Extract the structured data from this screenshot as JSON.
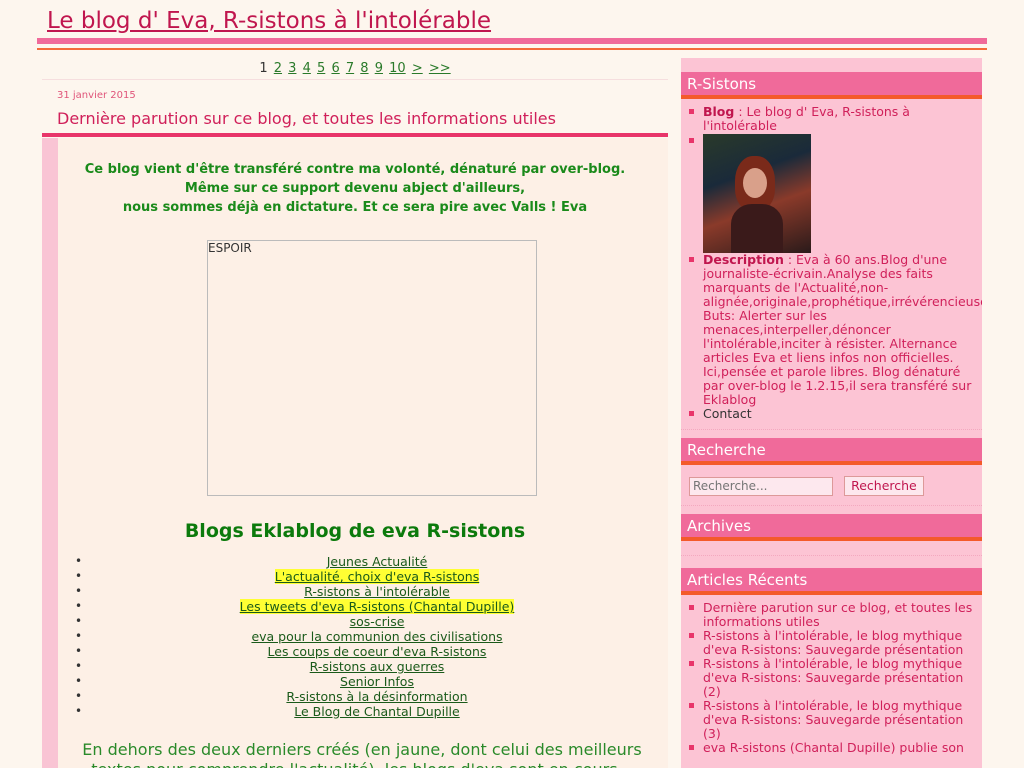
{
  "site": {
    "title": "Le blog d' Eva, R-sistons à l'intolérable"
  },
  "pager": {
    "current": "1",
    "pages": [
      "2",
      "3",
      "4",
      "5",
      "6",
      "7",
      "8",
      "9",
      "10"
    ],
    "next": ">",
    "last": ">>"
  },
  "post": {
    "date": "31 janvier 2015",
    "title": "Dernière parution sur ce blog, et toutes les informations utiles",
    "intro": [
      "Ce blog vient d'être transféré contre ma volonté, dénaturé par over-blog.",
      "Même sur ce support devenu abject d'ailleurs,",
      "nous sommes déjà en dictature. Et ce sera pire avec Valls ! Eva"
    ],
    "frame_label": "ESPOIR",
    "blogs_heading": "Blogs Eklablog de eva R-sistons",
    "blogs": [
      "Jeunes Actualité",
      "L'actualité, choix d'eva R-sistons",
      "R-sistons à l'intolérable",
      "Les tweets d'eva R-sistons (Chantal Dupille)",
      "sos-crise",
      "eva pour la communion des civilisations",
      "Les coups de coeur d'eva R-sistons",
      "R-sistons aux guerres",
      "Senior Infos",
      "R-sistons à la désinformation",
      "Le Blog de Chantal Dupille"
    ],
    "outro": "En dehors des deux derniers créés (en jaune, dont celui des meilleurs textes pour comprendre l'actualité), les blogs d'eva sont en cours... assez"
  },
  "sidebar": {
    "rsistons": {
      "heading": "R-Sistons",
      "blog_label": "Blog",
      "blog_value": " : Le blog d' Eva, R-sistons à l'intolérable",
      "description_label": "Description",
      "description_value": " : Eva à 60 ans.Blog d'une journaliste-écrivain.Analyse des faits marquants de l'Actualité,non-alignée,originale,prophétique,irrévérencieuse Buts: Alerter sur les menaces,interpeller,dénoncer l'intolérable,inciter à résister. Alternance articles Eva et liens infos non officielles. Ici,pensée et parole libres. Blog dénaturé par over-blog le 1.2.15,il sera transféré sur Eklablog",
      "contact": "Contact"
    },
    "search": {
      "heading": "Recherche",
      "placeholder": "Recherche...",
      "button": "Recherche"
    },
    "archives": {
      "heading": "Archives"
    },
    "recent": {
      "heading": "Articles Récents",
      "items": [
        "Dernière parution sur ce blog, et toutes les informations utiles",
        "R-sistons à l'intolérable, le blog mythique d'eva R-sistons: Sauvegarde présentation",
        "R-sistons à l'intolérable, le blog mythique d'eva R-sistons: Sauvegarde présentation (2)",
        "R-sistons à l'intolérable, le blog mythique d'eva R-sistons: Sauvegarde présentation (3)",
        "eva R-sistons (Chantal Dupille) publie son"
      ]
    }
  },
  "colors": {
    "accent": "#f06a9a",
    "title": "#c0164e",
    "green": "#1a8a1a",
    "highlight": "#ffff33"
  }
}
